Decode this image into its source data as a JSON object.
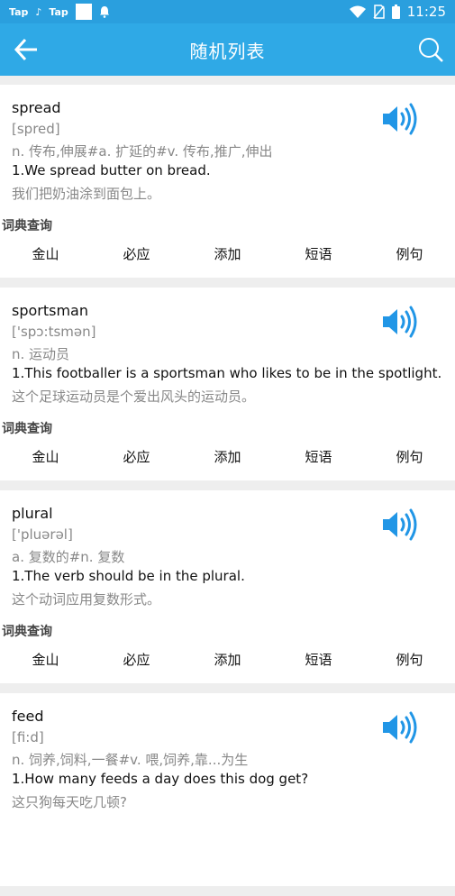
{
  "status_bar": {
    "left_labels": [
      "Tap",
      "Tap"
    ],
    "tiktok_glyph": "♪",
    "time": "11:25",
    "icons": [
      "wifi-icon",
      "no-sim-icon",
      "battery-icon",
      "notification-bell-icon"
    ]
  },
  "app_bar": {
    "title": "随机列表",
    "back_icon": "back-arrow-icon",
    "search_icon": "search-icon"
  },
  "colors": {
    "status_bar": "#2a9fde",
    "app_bar": "#2fa9e6",
    "speaker": "#2196e6",
    "background": "#eeeeee"
  },
  "dict_label": "词典查询",
  "actions": [
    "金山",
    "必应",
    "添加",
    "短语",
    "例句"
  ],
  "entries": [
    {
      "word": "spread",
      "phonetic": "[spred]",
      "definition": "n. 传布,伸展#a. 扩延的#v. 传布,推广,伸出",
      "example_en": "1.We spread butter on bread.",
      "example_zh": "我们把奶油涂到面包上。"
    },
    {
      "word": "sportsman",
      "phonetic": "['spɔ:tsmən]",
      "definition": "n. 运动员",
      "example_en": "1.This footballer is a sportsman who likes to be in the spotlight.",
      "example_zh": "这个足球运动员是个爱出风头的运动员。"
    },
    {
      "word": "plural",
      "phonetic": "['pluərəl]",
      "definition": "a. 复数的#n. 复数",
      "example_en": "1.The verb should be in the plural.",
      "example_zh": "这个动词应用复数形式。"
    },
    {
      "word": "feed",
      "phonetic": "[fi:d]",
      "definition": "n. 饲养,饲料,一餐#v. 喂,饲养,靠...为生",
      "example_en": "1.How many feeds a day does this dog get?",
      "example_zh": "这只狗每天吃几顿?"
    }
  ]
}
